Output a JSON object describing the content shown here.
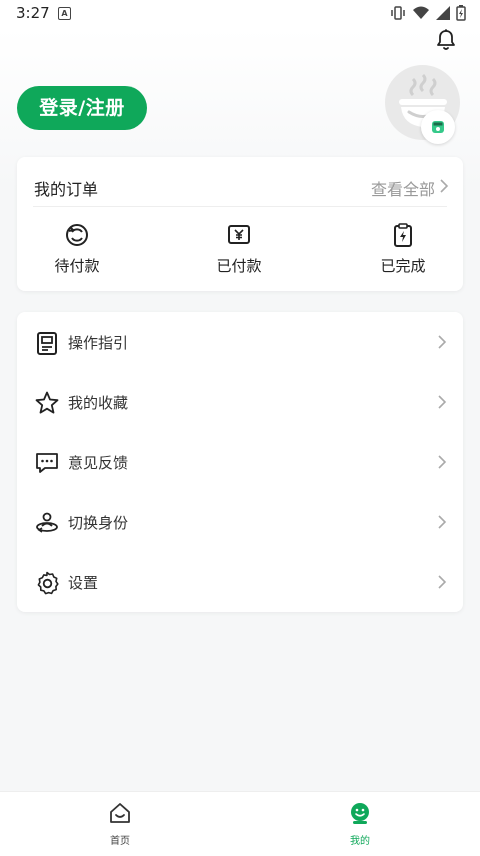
{
  "status_bar": {
    "time": "3:27",
    "indicator": "A"
  },
  "header": {
    "login_label": "登录/注册"
  },
  "orders": {
    "title": "我的订单",
    "view_all": "查看全部",
    "items": [
      {
        "label": "待付款",
        "icon": "pending-payment-icon"
      },
      {
        "label": "已付款",
        "icon": "yuan-icon"
      },
      {
        "label": "已完成",
        "icon": "clipboard-completed-icon"
      }
    ]
  },
  "menu": {
    "items": [
      {
        "label": "操作指引",
        "icon": "guide-document-icon"
      },
      {
        "label": "我的收藏",
        "icon": "star-icon"
      },
      {
        "label": "意见反馈",
        "icon": "feedback-chat-icon"
      },
      {
        "label": "切换身份",
        "icon": "switch-identity-icon"
      },
      {
        "label": "设置",
        "icon": "gear-icon"
      }
    ]
  },
  "tabbar": {
    "tabs": [
      {
        "label": "首页",
        "icon": "home-icon",
        "active": false
      },
      {
        "label": "我的",
        "icon": "profile-smile-icon",
        "active": true
      }
    ]
  },
  "colors": {
    "accent": "#0fa85a",
    "muted": "#999999",
    "active_tab": "#0fa85a",
    "inactive_tab": "#444444"
  }
}
